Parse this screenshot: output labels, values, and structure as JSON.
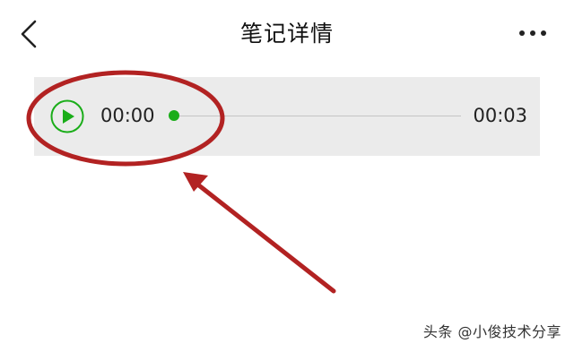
{
  "header": {
    "title": "笔记详情",
    "back_icon": "chevron-left-icon",
    "more_icon": "more-dots-icon"
  },
  "player": {
    "play_icon": "play-icon",
    "current_time": "00:00",
    "total_time": "00:03",
    "progress": 0.0,
    "accent_color": "#1aad19"
  },
  "annotation": {
    "color": "#b22222",
    "shapes": [
      "ellipse-highlight",
      "arrow-pointer"
    ]
  },
  "watermark": {
    "text": "头条 @小俊技术分享"
  }
}
